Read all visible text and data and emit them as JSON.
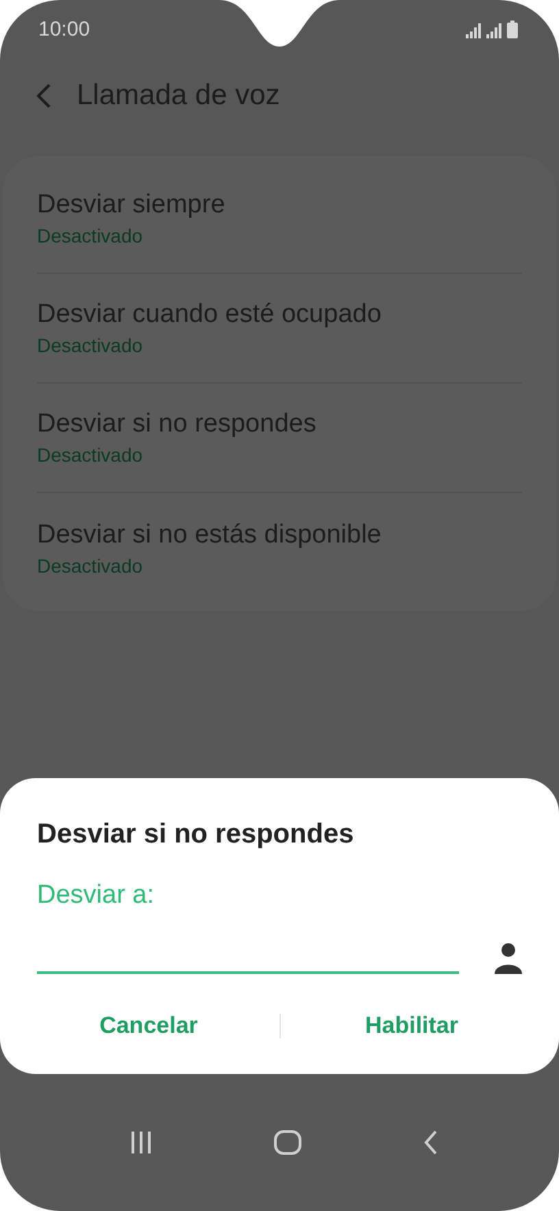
{
  "status_bar": {
    "time": "10:00"
  },
  "header": {
    "title": "Llamada de voz"
  },
  "settings": [
    {
      "title": "Desviar siempre",
      "status": "Desactivado"
    },
    {
      "title": "Desviar cuando esté ocupado",
      "status": "Desactivado"
    },
    {
      "title": "Desviar si no respondes",
      "status": "Desactivado"
    },
    {
      "title": "Desviar si no estás disponible",
      "status": "Desactivado"
    }
  ],
  "dialog": {
    "title": "Desviar si no respondes",
    "field_label": "Desviar a:",
    "buttons": [
      "Cancelar",
      "Habilitar"
    ]
  }
}
